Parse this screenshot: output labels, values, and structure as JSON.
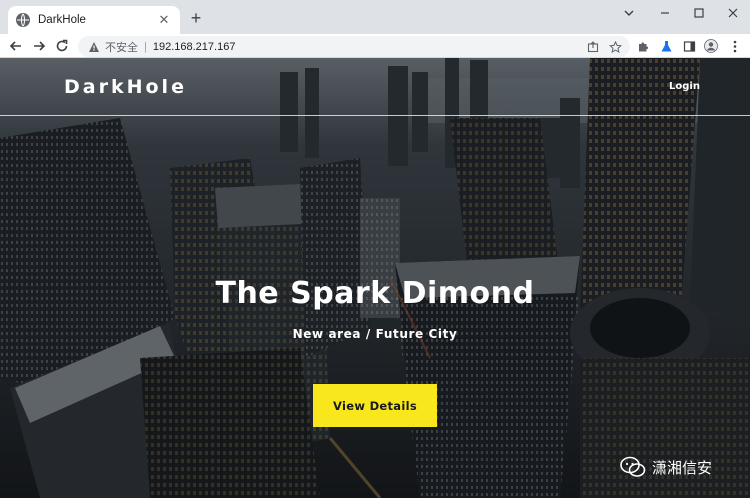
{
  "browser": {
    "tab": {
      "title": "DarkHole"
    },
    "address": {
      "security_label": "不安全",
      "url": "192.168.217.167"
    }
  },
  "site": {
    "brand": "DarkHole",
    "nav": {
      "login": "Login"
    },
    "hero": {
      "title": "The Spark Dimond",
      "subtitle": "New area / Future City",
      "cta": "View Details"
    },
    "colors": {
      "cta_background": "#f8e71c",
      "text": "#ffffff"
    }
  },
  "watermark": {
    "text": "潇湘信安"
  },
  "icons": {
    "tab_favicon": "globe-icon",
    "tab_close": "close-icon",
    "new_tab": "plus-icon",
    "back": "arrow-left-icon",
    "forward": "arrow-right-icon",
    "reload": "reload-icon",
    "security": "warning-icon",
    "share": "share-icon",
    "bookmark": "star-icon",
    "extensions": "puzzle-icon",
    "lab": "flask-icon",
    "side_panel": "side-panel-icon",
    "profile": "profile-icon",
    "menu": "kebab-menu-icon"
  }
}
